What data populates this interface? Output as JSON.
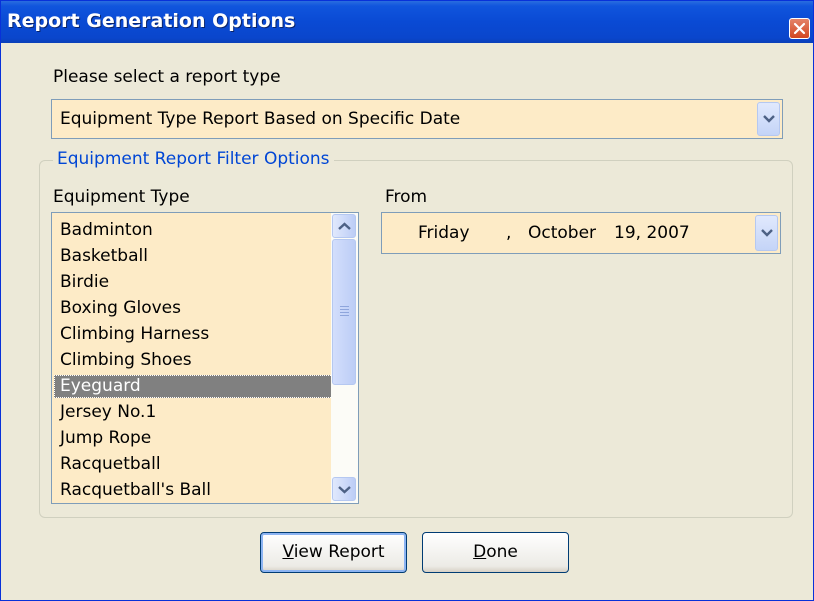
{
  "window": {
    "title": "Report Generation Options"
  },
  "report_type": {
    "label": "Please select a report type",
    "selected": "Equipment Type Report Based on Specific Date"
  },
  "filter_group": {
    "title": "Equipment Report Filter Options",
    "equipment_type_label": "Equipment Type",
    "from_label": "From",
    "equipment_items": [
      "Badminton",
      "Basketball",
      "Birdie",
      "Boxing Gloves",
      "Climbing Harness",
      "Climbing Shoes",
      "Eyeguard",
      "Jersey No.1",
      "Jump Rope",
      "Racquetball",
      "Racquetball's Ball"
    ],
    "selected_item": "Eyeguard",
    "date": {
      "weekday": "Friday",
      "separator": ",",
      "month": "October",
      "day_year": "19, 2007"
    }
  },
  "buttons": {
    "view_report_mnemonic": "V",
    "view_report_rest": "iew Report",
    "done_mnemonic": "D",
    "done_rest": "one"
  },
  "colors": {
    "field_bg": "#fdebc7",
    "title_bar": "#0a4ad4",
    "group_title": "#0046d5",
    "dialog_bg": "#ece9d8"
  },
  "icons": [
    "close-icon",
    "chevron-down-icon",
    "chevron-up-icon",
    "scroll-grip-icon"
  ]
}
